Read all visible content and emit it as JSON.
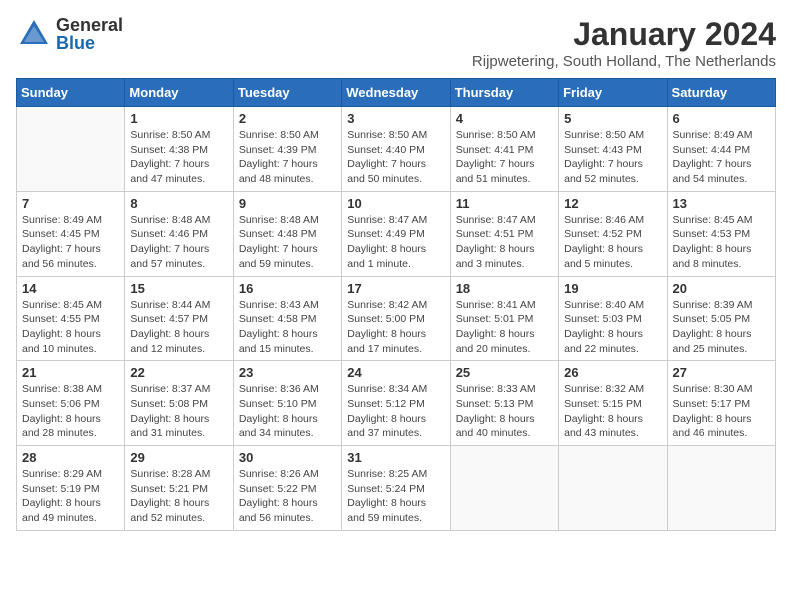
{
  "header": {
    "logo_general": "General",
    "logo_blue": "Blue",
    "month_year": "January 2024",
    "subtitle": "Rijpwetering, South Holland, The Netherlands"
  },
  "weekdays": [
    "Sunday",
    "Monday",
    "Tuesday",
    "Wednesday",
    "Thursday",
    "Friday",
    "Saturday"
  ],
  "weeks": [
    [
      {
        "day": "",
        "detail": ""
      },
      {
        "day": "1",
        "detail": "Sunrise: 8:50 AM\nSunset: 4:38 PM\nDaylight: 7 hours\nand 47 minutes."
      },
      {
        "day": "2",
        "detail": "Sunrise: 8:50 AM\nSunset: 4:39 PM\nDaylight: 7 hours\nand 48 minutes."
      },
      {
        "day": "3",
        "detail": "Sunrise: 8:50 AM\nSunset: 4:40 PM\nDaylight: 7 hours\nand 50 minutes."
      },
      {
        "day": "4",
        "detail": "Sunrise: 8:50 AM\nSunset: 4:41 PM\nDaylight: 7 hours\nand 51 minutes."
      },
      {
        "day": "5",
        "detail": "Sunrise: 8:50 AM\nSunset: 4:43 PM\nDaylight: 7 hours\nand 52 minutes."
      },
      {
        "day": "6",
        "detail": "Sunrise: 8:49 AM\nSunset: 4:44 PM\nDaylight: 7 hours\nand 54 minutes."
      }
    ],
    [
      {
        "day": "7",
        "detail": "Sunrise: 8:49 AM\nSunset: 4:45 PM\nDaylight: 7 hours\nand 56 minutes."
      },
      {
        "day": "8",
        "detail": "Sunrise: 8:48 AM\nSunset: 4:46 PM\nDaylight: 7 hours\nand 57 minutes."
      },
      {
        "day": "9",
        "detail": "Sunrise: 8:48 AM\nSunset: 4:48 PM\nDaylight: 7 hours\nand 59 minutes."
      },
      {
        "day": "10",
        "detail": "Sunrise: 8:47 AM\nSunset: 4:49 PM\nDaylight: 8 hours\nand 1 minute."
      },
      {
        "day": "11",
        "detail": "Sunrise: 8:47 AM\nSunset: 4:51 PM\nDaylight: 8 hours\nand 3 minutes."
      },
      {
        "day": "12",
        "detail": "Sunrise: 8:46 AM\nSunset: 4:52 PM\nDaylight: 8 hours\nand 5 minutes."
      },
      {
        "day": "13",
        "detail": "Sunrise: 8:45 AM\nSunset: 4:53 PM\nDaylight: 8 hours\nand 8 minutes."
      }
    ],
    [
      {
        "day": "14",
        "detail": "Sunrise: 8:45 AM\nSunset: 4:55 PM\nDaylight: 8 hours\nand 10 minutes."
      },
      {
        "day": "15",
        "detail": "Sunrise: 8:44 AM\nSunset: 4:57 PM\nDaylight: 8 hours\nand 12 minutes."
      },
      {
        "day": "16",
        "detail": "Sunrise: 8:43 AM\nSunset: 4:58 PM\nDaylight: 8 hours\nand 15 minutes."
      },
      {
        "day": "17",
        "detail": "Sunrise: 8:42 AM\nSunset: 5:00 PM\nDaylight: 8 hours\nand 17 minutes."
      },
      {
        "day": "18",
        "detail": "Sunrise: 8:41 AM\nSunset: 5:01 PM\nDaylight: 8 hours\nand 20 minutes."
      },
      {
        "day": "19",
        "detail": "Sunrise: 8:40 AM\nSunset: 5:03 PM\nDaylight: 8 hours\nand 22 minutes."
      },
      {
        "day": "20",
        "detail": "Sunrise: 8:39 AM\nSunset: 5:05 PM\nDaylight: 8 hours\nand 25 minutes."
      }
    ],
    [
      {
        "day": "21",
        "detail": "Sunrise: 8:38 AM\nSunset: 5:06 PM\nDaylight: 8 hours\nand 28 minutes."
      },
      {
        "day": "22",
        "detail": "Sunrise: 8:37 AM\nSunset: 5:08 PM\nDaylight: 8 hours\nand 31 minutes."
      },
      {
        "day": "23",
        "detail": "Sunrise: 8:36 AM\nSunset: 5:10 PM\nDaylight: 8 hours\nand 34 minutes."
      },
      {
        "day": "24",
        "detail": "Sunrise: 8:34 AM\nSunset: 5:12 PM\nDaylight: 8 hours\nand 37 minutes."
      },
      {
        "day": "25",
        "detail": "Sunrise: 8:33 AM\nSunset: 5:13 PM\nDaylight: 8 hours\nand 40 minutes."
      },
      {
        "day": "26",
        "detail": "Sunrise: 8:32 AM\nSunset: 5:15 PM\nDaylight: 8 hours\nand 43 minutes."
      },
      {
        "day": "27",
        "detail": "Sunrise: 8:30 AM\nSunset: 5:17 PM\nDaylight: 8 hours\nand 46 minutes."
      }
    ],
    [
      {
        "day": "28",
        "detail": "Sunrise: 8:29 AM\nSunset: 5:19 PM\nDaylight: 8 hours\nand 49 minutes."
      },
      {
        "day": "29",
        "detail": "Sunrise: 8:28 AM\nSunset: 5:21 PM\nDaylight: 8 hours\nand 52 minutes."
      },
      {
        "day": "30",
        "detail": "Sunrise: 8:26 AM\nSunset: 5:22 PM\nDaylight: 8 hours\nand 56 minutes."
      },
      {
        "day": "31",
        "detail": "Sunrise: 8:25 AM\nSunset: 5:24 PM\nDaylight: 8 hours\nand 59 minutes."
      },
      {
        "day": "",
        "detail": ""
      },
      {
        "day": "",
        "detail": ""
      },
      {
        "day": "",
        "detail": ""
      }
    ]
  ]
}
